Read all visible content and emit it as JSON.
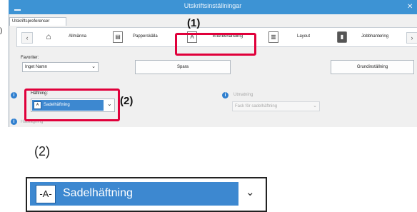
{
  "window": {
    "title": "Utskriftsinställningar",
    "close": "✕"
  },
  "outer_label": ")",
  "tab": {
    "label": "Utskriftspreferenser"
  },
  "categories": [
    {
      "label": "Allmänna",
      "icon": "home-icon"
    },
    {
      "label": "Papperskälla",
      "icon": "paper-tray-icon"
    },
    {
      "label": "Efterbehandling",
      "icon": "finishing-icon"
    },
    {
      "label": "Layout",
      "icon": "layout-icon"
    },
    {
      "label": "Jobbhantering",
      "icon": "job-handling-icon"
    }
  ],
  "nav": {
    "prev": "‹",
    "next": "›"
  },
  "favorites": {
    "label": "Favoriter:",
    "value": "Inget Namn",
    "save": "Spara",
    "defaults": "Grundinställning"
  },
  "stapling": {
    "label": "Häftning:",
    "value": "Sadelhäftning"
  },
  "output": {
    "label": "Utmatning",
    "value": "Fack för sadelhäftning"
  },
  "punch": {
    "label": "Hålslagning"
  },
  "callouts": {
    "one": "(1)",
    "two": "(2)"
  },
  "zoom": {
    "heading": "(2)",
    "value": "Sadelhäftning",
    "icon_glyph": "-A-"
  },
  "colors": {
    "accent": "#3d93d4",
    "highlight": "#e0003b",
    "selected": "#3d88d0"
  }
}
